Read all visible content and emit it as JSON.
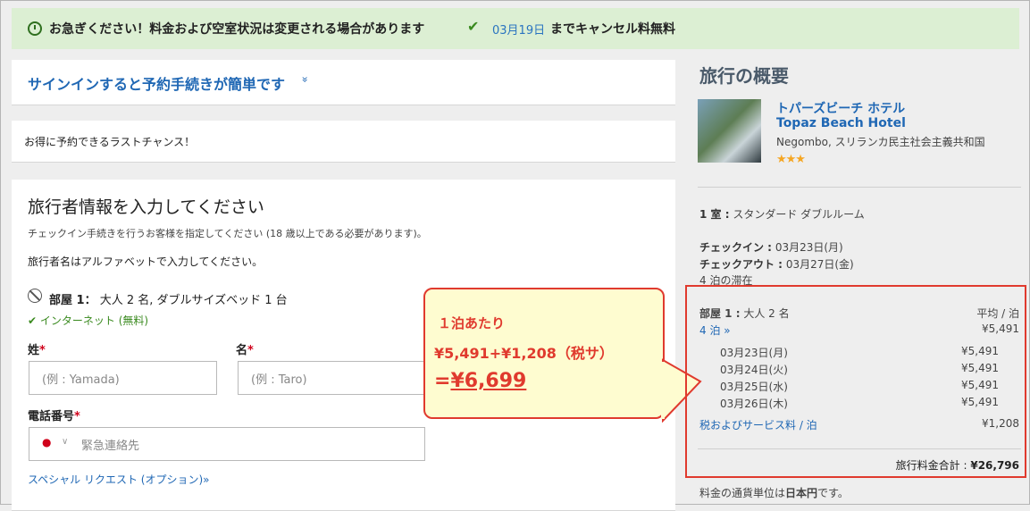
{
  "alert": {
    "message": "お急ぎください！料金および空室状況は変更される場合があります",
    "cancel_date": "03月19日",
    "cancel_text": "までキャンセル料無料"
  },
  "signin": {
    "label": "サインインすると予約手続きが簡単です",
    "chevron": "»"
  },
  "last_chance": "お得に予約できるラストチャンス！",
  "form": {
    "heading": "旅行者情報を入力してください",
    "subtitle": "チェックイン手続きを行うお客様を指定してください (18 歳以上である必要があります)。",
    "note": "旅行者名はアルファベットで入力してください。",
    "room_label": "部屋 1：",
    "room_desc": "大人 2 名, ダブルサイズベッド 1 台",
    "internet": "インターネット (無料)",
    "last_name_label": "姓",
    "last_name_placeholder": "(例 : Yamada)",
    "first_name_label": "名",
    "first_name_placeholder": "(例 : Taro)",
    "phone_label": "電話番号",
    "phone_placeholder": "緊急連絡先",
    "required_mark": "*",
    "special_request": "スペシャル リクエスト (オプション)»"
  },
  "callout": {
    "line1": "１泊あたり",
    "line2": "¥5,491+¥1,208（税サ）",
    "line3_prefix": "=",
    "line3_value": "¥6,699"
  },
  "summary": {
    "title": "旅行の概要",
    "hotel_name_jp": "トパーズビーチ ホテル",
    "hotel_name_en": "Topaz Beach Hotel",
    "location": "Negombo, スリランカ民主社会主義共和国",
    "stars": "★★★",
    "room_label": "1 室 :",
    "room_type": "スタンダード ダブルルーム",
    "checkin_label": "チェックイン :",
    "checkin_value": "03月23日(月)",
    "checkout_label": "チェックアウト :",
    "checkout_value": "03月27日(金)",
    "stay": "4 泊の滞在",
    "price_room_label": "部屋 1 :",
    "price_room_desc": "大人 2 名",
    "avg_label": "平均 / 泊",
    "nights_link": "4 泊 »",
    "nights_avg": "¥5,491",
    "nightly": [
      {
        "date": "03月23日(月)",
        "price": "¥5,491"
      },
      {
        "date": "03月24日(火)",
        "price": "¥5,491"
      },
      {
        "date": "03月25日(水)",
        "price": "¥5,491"
      },
      {
        "date": "03月26日(木)",
        "price": "¥5,491"
      }
    ],
    "tax_label": "税およびサービス料 / 泊",
    "tax_value": "¥1,208",
    "total_label": "旅行料金合計 :",
    "total_value": "¥26,796",
    "currency_prefix": "料金の通貨単位は",
    "currency_bold": "日本円",
    "currency_suffix": "です。"
  },
  "colors": {
    "accent_red": "#e03a2e",
    "link_blue": "#1f67b4",
    "alert_green": "#dcefd3"
  }
}
